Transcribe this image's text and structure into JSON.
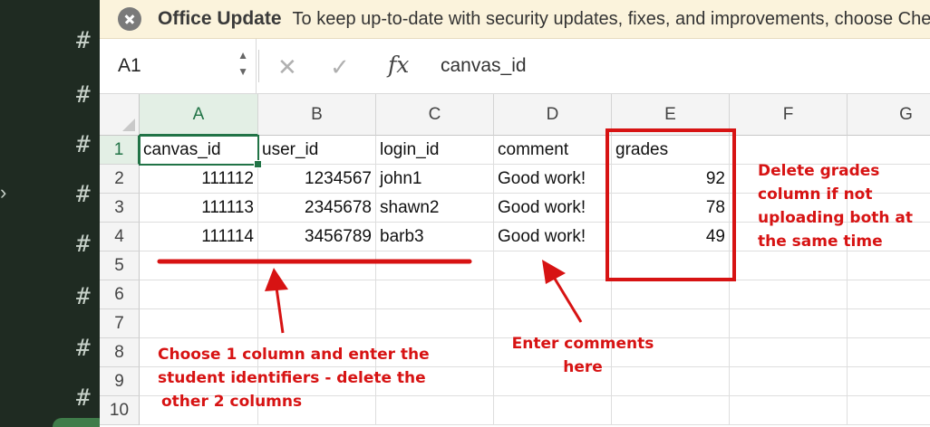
{
  "message_bar": {
    "title": "Office Update",
    "text": "To keep up-to-date with security updates, fixes, and improvements, choose Check for Updates."
  },
  "formula_bar": {
    "name_box": "A1",
    "cancel_icon": "x-icon",
    "enter_icon": "check-icon",
    "fx_label": "fx",
    "value": "canvas_id"
  },
  "columns": [
    "A",
    "B",
    "C",
    "D",
    "E",
    "F",
    "G"
  ],
  "rows": [
    "1",
    "2",
    "3",
    "4",
    "5",
    "6",
    "7",
    "8",
    "9",
    "10"
  ],
  "cells": {
    "A1": "canvas_id",
    "B1": "user_id",
    "C1": "login_id",
    "D1": "comment",
    "E1": "grades",
    "A2": "111112",
    "B2": "1234567",
    "C2": "john1",
    "D2": "Good work!",
    "E2": "92",
    "A3": "111113",
    "B3": "2345678",
    "C3": "shawn2",
    "D3": "Good work!",
    "E3": "78",
    "A4": "111114",
    "B4": "3456789",
    "C4": "barb3",
    "D4": "Good work!",
    "E4": "49"
  },
  "annotations": {
    "grades": [
      "Delete grades",
      "column if not",
      "uploading both at",
      "the same time"
    ],
    "comments": [
      "Enter comments",
      "here"
    ],
    "identifiers": [
      "Choose 1 column and enter the",
      "student identifiers - delete the",
      "other  2 columns"
    ]
  },
  "colors": {
    "annotation": "#d71313",
    "excel_green": "#217346",
    "message_bar": "#fbf3dc"
  }
}
